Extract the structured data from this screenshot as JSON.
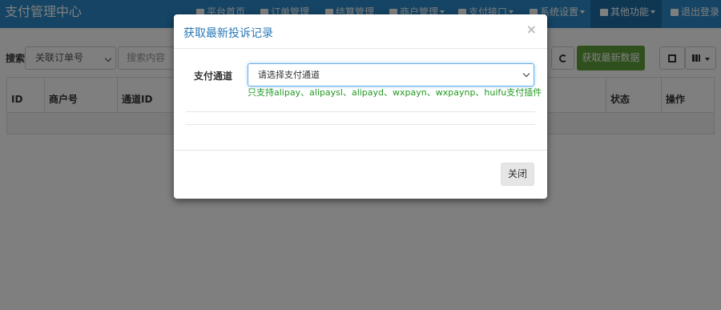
{
  "navbar": {
    "brand": "支付管理中心",
    "items": [
      {
        "label": "平台首页",
        "icon": "home-icon",
        "has_caret": false
      },
      {
        "label": "订单管理",
        "icon": "list-icon",
        "has_caret": false
      },
      {
        "label": "结算管理",
        "icon": "cloud-icon",
        "has_caret": false
      },
      {
        "label": "商户管理",
        "icon": "user-icon",
        "has_caret": true
      },
      {
        "label": "支付接口",
        "icon": "credit-card-icon",
        "has_caret": true
      },
      {
        "label": "系统设置",
        "icon": "gear-icon",
        "has_caret": true
      },
      {
        "label": "其他功能",
        "icon": "cube-icon",
        "has_caret": true,
        "active": true
      },
      {
        "label": "退出登录",
        "icon": "power-icon",
        "has_caret": false
      }
    ]
  },
  "search": {
    "label": "搜索",
    "field_select": "关联订单号",
    "input_placeholder": "搜索内容"
  },
  "toolbar": {
    "fetch_label": "获取最新数据",
    "refresh_icon": "refresh-icon",
    "fullscreen_icon": "fullscreen-icon",
    "columns_icon": "columns-icon"
  },
  "table": {
    "headers": [
      "ID",
      "商户号",
      "通道ID",
      "状态",
      "操作"
    ]
  },
  "modal": {
    "title": "获取最新投诉记录",
    "close_glyph": "×",
    "field_label": "支付通道",
    "select_value": "请选择支付通道",
    "help_text": "只支持alipay、alipaysl、alipayd、wxpayn、wxpaynp、huifu支付插件",
    "close_button": "关闭"
  },
  "colors": {
    "navbar": "#2a89c9",
    "navbar_active": "#1c6fa8",
    "fetch_button": "#5ea13a",
    "modal_title": "#2a7ab8",
    "help_text": "#229922"
  }
}
